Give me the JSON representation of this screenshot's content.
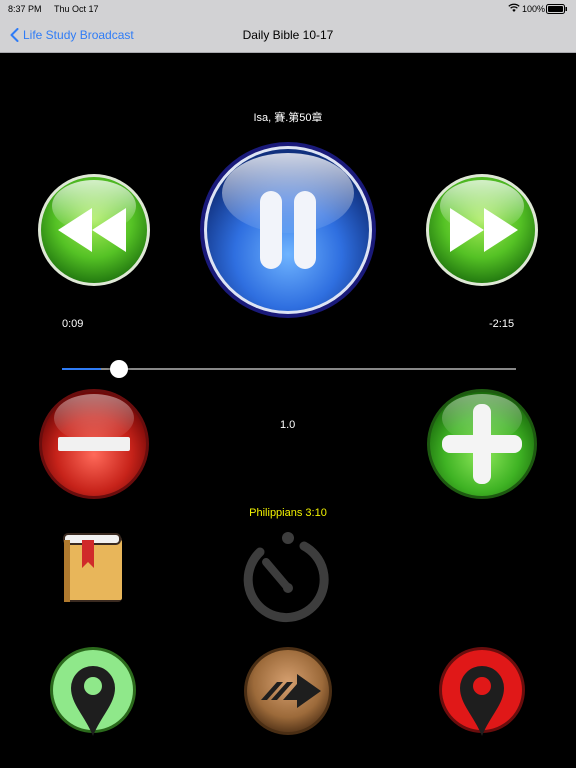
{
  "status": {
    "time": "8:37 PM",
    "date": "Thu Oct 17",
    "battery": "100%"
  },
  "nav": {
    "back_label": "Life Study Broadcast",
    "title": "Daily Bible 10-17"
  },
  "track": {
    "title": "Isa, 賽.第50章"
  },
  "playback": {
    "elapsed": "0:09",
    "remaining": "-2:15",
    "progress": 0.085,
    "speed": "1.0"
  },
  "verse": "Philippians 3:10",
  "colors": {
    "accent": "#2f7cf6",
    "verse": "#f2f200",
    "play": "#1e5fd8",
    "green": "#3fb324",
    "red": "#c21414"
  }
}
